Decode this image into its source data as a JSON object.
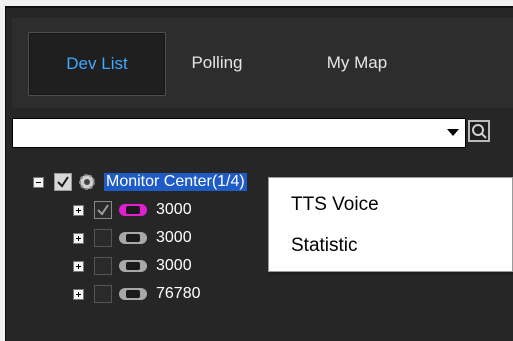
{
  "tabs": [
    {
      "label": "Dev List",
      "active": true
    },
    {
      "label": "Polling",
      "active": false
    },
    {
      "label": "My Map",
      "active": false
    }
  ],
  "search": {
    "value": "",
    "placeholder": ""
  },
  "tree": {
    "root": {
      "label": "Monitor Center(1/4)",
      "expanded": true,
      "checked": true
    },
    "devices": [
      {
        "label": "3000",
        "checked": "partial",
        "status_color": "#e020d0"
      },
      {
        "label": "3000",
        "checked": false,
        "status_color": "#a8a8a8"
      },
      {
        "label": "3000",
        "checked": false,
        "status_color": "#a8a8a8"
      },
      {
        "label": "76780",
        "checked": false,
        "status_color": "#a8a8a8"
      }
    ]
  },
  "context_menu": {
    "items": [
      "TTS Voice",
      "Statistic"
    ]
  },
  "colors": {
    "panel_bg": "#262626",
    "active_tab_text": "#3fa8ff",
    "selection_bg": "#1e5bc6"
  },
  "icons": {
    "search": "magnifier-icon",
    "dropdown": "chevron-down-icon",
    "root": "gear-icon",
    "device": "car-icon"
  }
}
